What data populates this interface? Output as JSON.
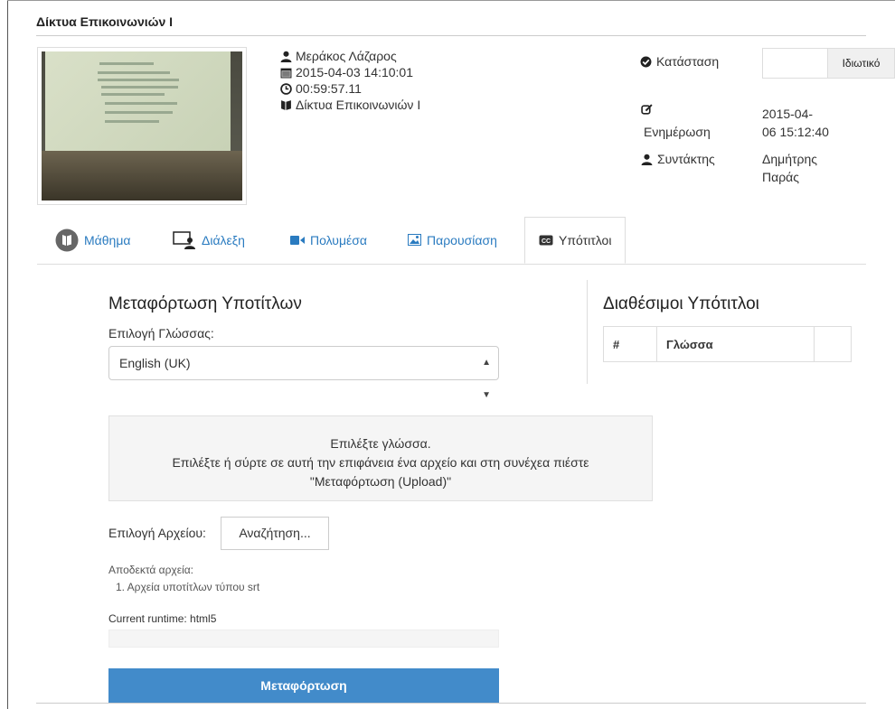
{
  "course": {
    "title": "Δίκτυα Επικοινωνιών Ι"
  },
  "lecture": {
    "author": "Μεράκος Λάζαρος",
    "datetime": "2015-04-03  14:10:01",
    "duration": "00:59:57.11",
    "course": "Δίκτυα Επικοινωνιών Ι"
  },
  "status": {
    "label": "Κατάσταση",
    "value": "Ιδιωτικό",
    "updated_label": "Ενημέρωση",
    "updated_value_line1": "2015-04-",
    "updated_value_line2": "06 15:12:40",
    "editor_label": "Συντάκτης",
    "editor_value_line1": "Δημήτρης",
    "editor_value_line2": "Παράς"
  },
  "tabs": [
    {
      "label": "Μάθημα",
      "icon": "course-icon"
    },
    {
      "label": "Διάλεξη",
      "icon": "lecture-icon"
    },
    {
      "label": "Πολυμέσα",
      "icon": "video-icon"
    },
    {
      "label": "Παρουσίαση",
      "icon": "image-icon"
    },
    {
      "label": "Υπότιτλοι",
      "icon": "cc-icon",
      "active": true
    }
  ],
  "upload": {
    "title": "Μεταφόρτωση Υποτίτλων",
    "language_label": "Επιλογή Γλώσσας:",
    "language_selected": "English (UK)",
    "dropzone_line1": "Επιλέξτε γλώσσα.",
    "dropzone_line2": "Επιλέξτε ή σύρτε σε αυτή την επιφάνεια ένα αρχείο και στη συνέχεα πιέστε",
    "dropzone_line3": "\"Μεταφόρτωση (Upload)\"",
    "file_label": "Επιλογή Αρχείου:",
    "browse_label": "Αναζήτηση...",
    "accepted_label": "Αποδεκτά αρχεία:",
    "accepted_item": "1. Αρχεία υποτίτλων τύπου srt",
    "runtime": "Current runtime: html5",
    "progress": 0,
    "button_label": "Μεταφόρτωση"
  },
  "available": {
    "title": "Διαθέσιμοι Υπότιτλοι",
    "columns": [
      "#",
      "Γλώσσα",
      ""
    ]
  },
  "colors": {
    "link": "#2a7bc0",
    "primary": "#428bca"
  }
}
